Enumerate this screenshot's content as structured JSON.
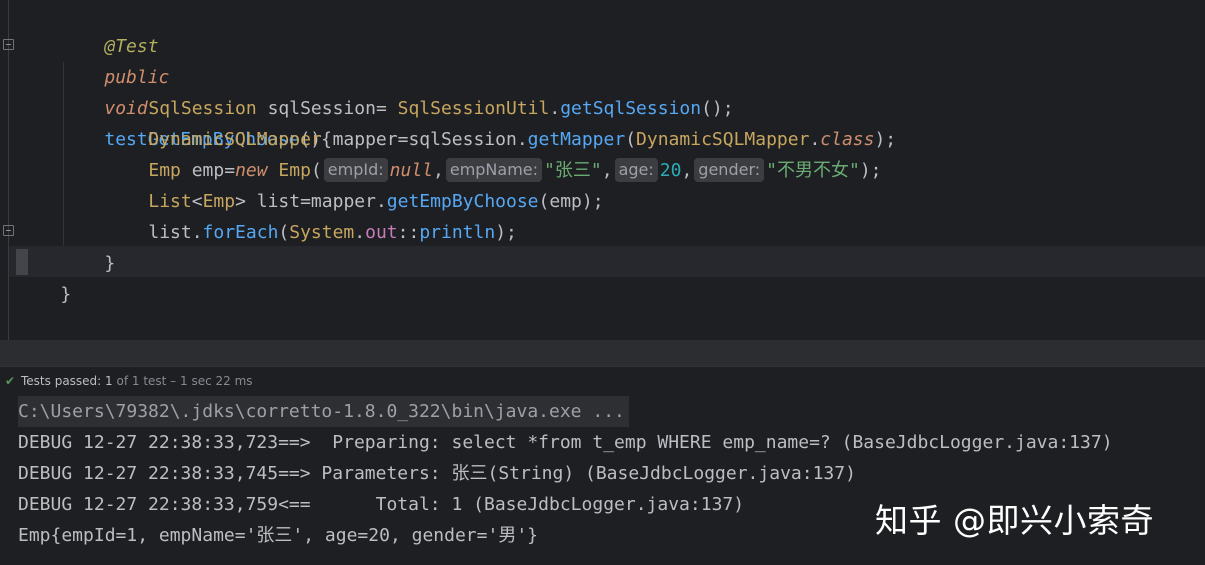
{
  "editor": {
    "lines": {
      "l1": {
        "annotation": "@Test"
      },
      "l2": {
        "kw_public": "public",
        "kw_void": "void",
        "method_name": "testGetEmpByChoose",
        "rest": "(){"
      },
      "l3": {
        "type1": "SqlSession",
        "var": " sqlSession= ",
        "type2": "SqlSessionUtil",
        "dot": ".",
        "method": "getSqlSession",
        "end": "();"
      },
      "l4": {
        "type1": "DynamicSQLMapper",
        "var": " mapper=sqlSession.",
        "method": "getMapper",
        "open": "(",
        "type2": "DynamicSQLMapper",
        "dot": ".",
        "kw_class": "class",
        "end": ");"
      },
      "l5": {
        "type1": "Emp",
        "var": " emp=",
        "kw_new": "new",
        "space": " ",
        "type2": "Emp",
        "open": "(",
        "hint_empId": "empId:",
        "null_kw": "null",
        "comma1": ",",
        "hint_empName": "empName:",
        "str_name": "\"张三\"",
        "comma2": ",",
        "hint_age": "age:",
        "num_age": "20",
        "comma3": ",",
        "hint_gender": "gender:",
        "str_gender": "\"不男不女\"",
        "end": ");"
      },
      "l6": {
        "type1": "List",
        "lt": "<",
        "type2": "Emp",
        "rest": "> list=mapper.",
        "method": "getEmpByChoose",
        "end": "(emp);"
      },
      "l7": {
        "start": "list.",
        "method": "forEach",
        "open": "(",
        "type": "System",
        "dot": ".",
        "field": "out",
        "sep": "::",
        "method2": "println",
        "end": ");"
      },
      "l8": {
        "text": "}"
      },
      "l9": {
        "text": "}"
      }
    }
  },
  "test_status": {
    "check_icon": "check-icon",
    "label": "Tests passed: 1",
    "detail": " of 1 test – 1 sec 22 ms"
  },
  "console": {
    "command": "C:\\Users\\79382\\.jdks\\corretto-1.8.0_322\\bin\\java.exe ...",
    "line1": "DEBUG 12-27 22:38:33,723==>  Preparing: select *from t_emp WHERE emp_name=? (BaseJdbcLogger.java:137)",
    "line2": "DEBUG 12-27 22:38:33,745==> Parameters: 张三(String) (BaseJdbcLogger.java:137)",
    "line3": "DEBUG 12-27 22:38:33,759<==      Total: 1 (BaseJdbcLogger.java:137)",
    "line4": "Emp{empId=1, empName='张三', age=20, gender='男'}"
  },
  "watermark": "知乎 @即兴小索奇",
  "colors": {
    "background": "#1e1f22",
    "keyword": "#cf8e6d",
    "method": "#56a8f5",
    "type": "#c7a65f",
    "string": "#6aab73",
    "number": "#2aacb8",
    "success": "#57965c"
  }
}
